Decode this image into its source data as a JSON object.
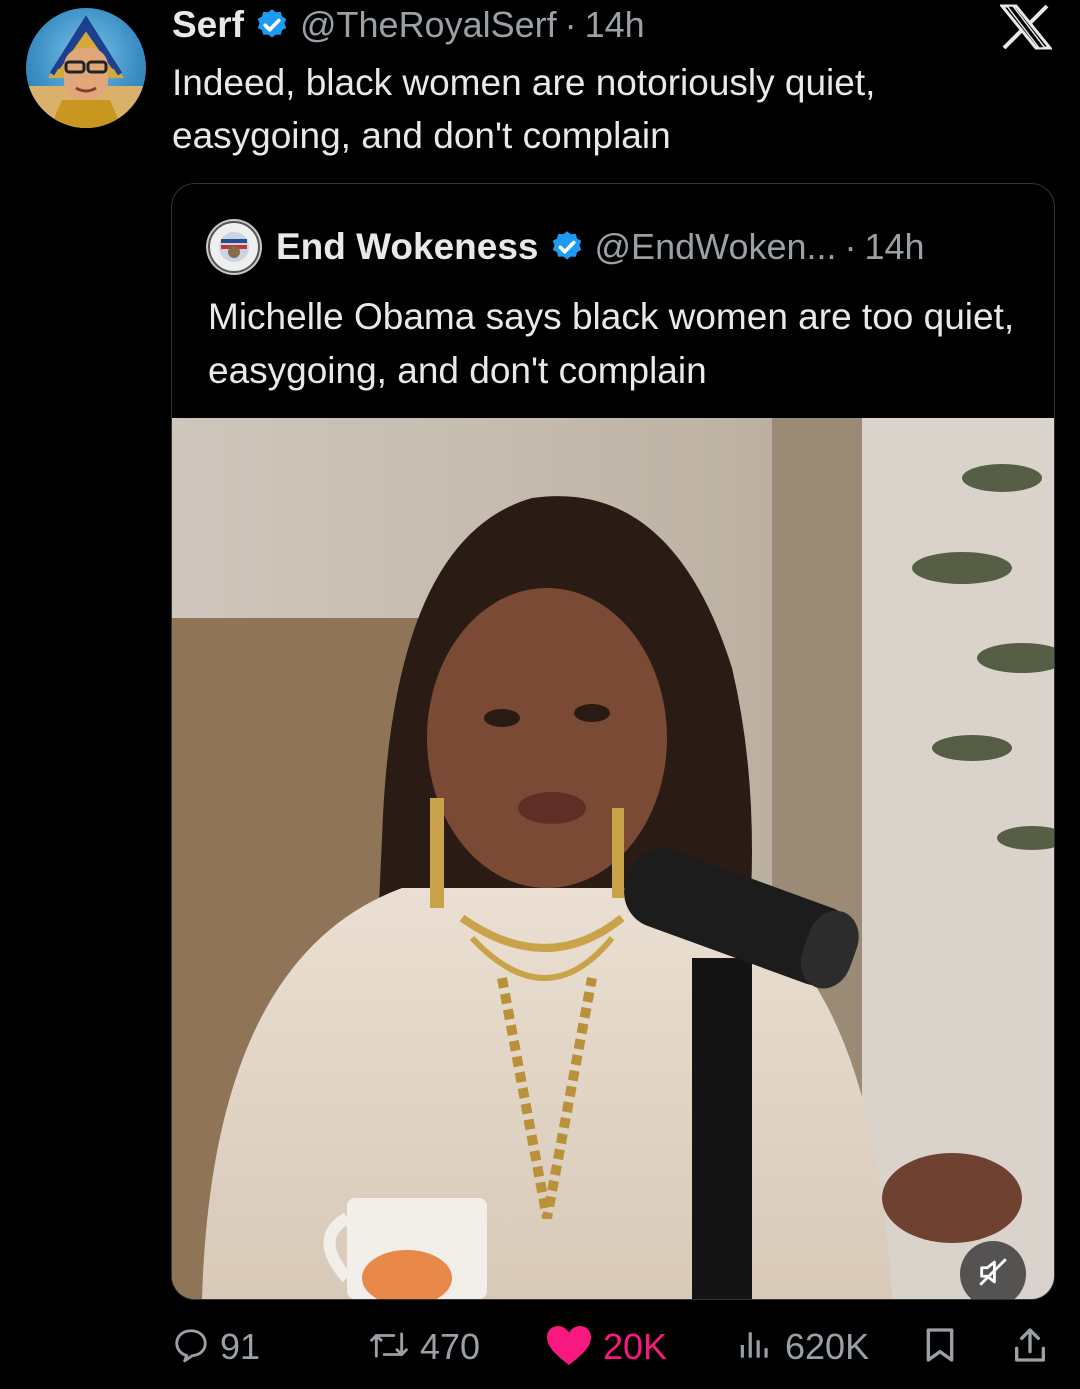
{
  "post": {
    "author_name": "Serf",
    "handle": "@TheRoyalSerf",
    "separator": "·",
    "time": "14h",
    "text": "Indeed, black women are notoriously quiet, easygoing, and don't complain"
  },
  "quoted": {
    "author_name": "End Wokeness",
    "handle": "@EndWoken...",
    "separator": "·",
    "time": "14h",
    "text": "Michelle Obama says black women are too quiet, easygoing, and don't complain"
  },
  "metrics": {
    "replies": "91",
    "reposts": "470",
    "likes": "20K",
    "views": "620K"
  },
  "colors": {
    "background": "#000000",
    "verified": "#1d9bf0",
    "like": "#f91880",
    "secondary_text": "#9aa0a6"
  },
  "icons": [
    "verified-badge-icon",
    "x-logo-icon",
    "mute-icon",
    "reply-icon",
    "repost-icon",
    "like-icon",
    "views-icon",
    "bookmark-icon",
    "share-icon"
  ]
}
